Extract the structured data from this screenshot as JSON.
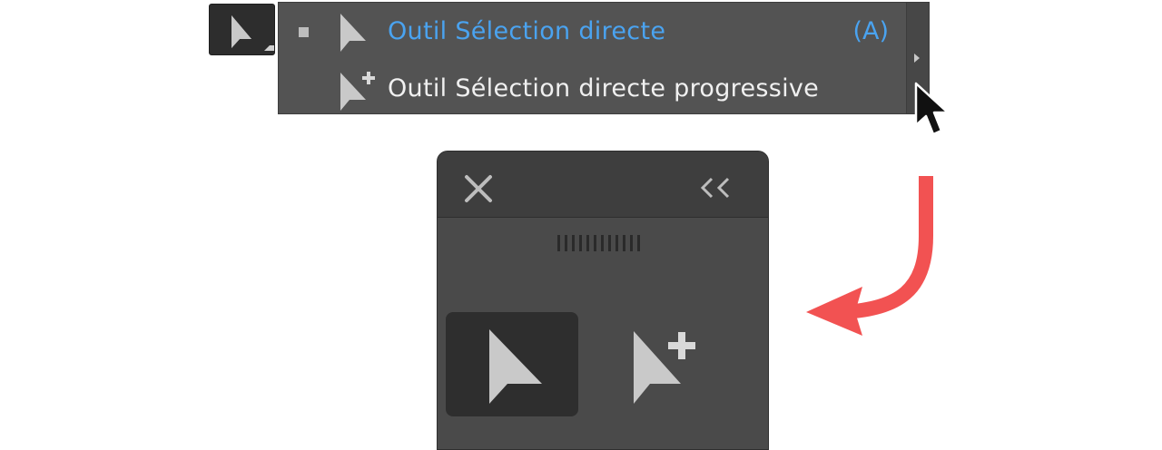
{
  "tool_button": {
    "icon": "direct-selection-arrow-icon"
  },
  "flyout": {
    "items": [
      {
        "label": "Outil Sélection directe",
        "shortcut": "(A)",
        "selected": true,
        "icon": "direct-selection-arrow-icon"
      },
      {
        "label": "Outil Sélection directe progressive",
        "shortcut": "",
        "selected": false,
        "icon": "group-selection-arrow-icon"
      }
    ],
    "tearoff_icon": "triangle-right-icon"
  },
  "panel": {
    "close_icon": "close-icon",
    "collapse_icon": "double-chevron-left-icon",
    "tools": [
      {
        "icon": "direct-selection-arrow-icon",
        "active": true
      },
      {
        "icon": "group-selection-arrow-icon",
        "active": false
      }
    ]
  },
  "colors": {
    "accent": "#4aa3f0",
    "panel_bg": "#4a4a4a",
    "arrow_annotation": "#f25252"
  }
}
